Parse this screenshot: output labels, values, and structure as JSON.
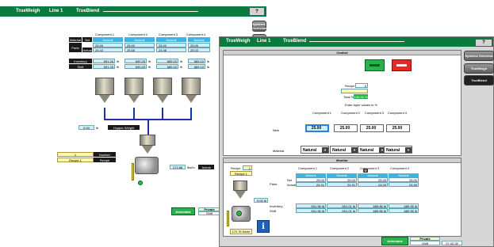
{
  "back": {
    "title_bar": {
      "app": "TrueWeigh",
      "line": "Line 1",
      "module": "TrueBlend",
      "help": "?"
    },
    "nav": {
      "systems": "Systems Overview",
      "trueweigh": "TrueWeigh"
    },
    "table": {
      "col_headers": [
        "Component 1",
        "Component 2",
        "Component 3",
        "Component 4"
      ],
      "material_label": "Material",
      "set_label": "Set",
      "parts_label": "Parts",
      "actual_label": "Actual",
      "material": [
        "Natural",
        "Natural",
        "Natural",
        "Natural"
      ],
      "set": [
        "25.00",
        "25.00",
        "25.00",
        "25.00"
      ],
      "actual": [
        "24.43",
        "25.65",
        "24.98",
        "25.03"
      ],
      "inventory_label": "Inventory",
      "shift_label": "Shift",
      "inventory": [
        "691.26",
        "690.29",
        "689.10",
        "689.10"
      ],
      "shift": [
        "691.25",
        "690.29",
        "689.10",
        "689.10"
      ],
      "unit": "lb"
    },
    "hopper_weight": {
      "value": "0.00",
      "unit": "lb",
      "label": "Hopper Weight"
    },
    "recipe": {
      "number_value": "1",
      "number_label": "Number",
      "name_value": "Recipe 1",
      "name_label": "Recipe"
    },
    "throughput": {
      "value": "172.88",
      "unit": "lbs/hr",
      "label": "Actual"
    },
    "bottom": {
      "automatic": "Automatic",
      "private": "Private",
      "shift": "Shift"
    }
  },
  "front": {
    "title_bar": {
      "app": "TrueWeigh",
      "line": "Line 1",
      "module": "TrueBlend",
      "help": "?"
    },
    "nav": {
      "systems": "Systems Overview",
      "trueweigh": "TrueWeigh",
      "trueblend": "TrueBlend"
    },
    "control": {
      "title": "Control",
      "recipe_label": "Recipe",
      "recipe_value": "0",
      "total_label": "Total %",
      "total_value": "100.00 %",
      "hint": "Enter layer values in  %",
      "col_headers": [
        "Component 1",
        "Component 2",
        "Component 3",
        "Component 4"
      ],
      "new_label": "New",
      "new_values": [
        "25.00",
        "25.00",
        "25.00",
        "25.00"
      ],
      "material_label": "Material",
      "materials": [
        "Natural",
        "Natural",
        "Natural",
        "Natural"
      ]
    },
    "monitor": {
      "title": "Monitor",
      "recipe_label": "Recipe",
      "recipe_value": "1",
      "recipe_name": "Recipe 1",
      "col_headers": [
        "Component 1",
        "Component 2",
        "Component 3",
        "Component 4"
      ],
      "materials": [
        "Natural",
        "Natural",
        "Natural",
        "Natural"
      ],
      "parts_label": "Parts",
      "set_label": "Set",
      "actual_label": "Actual",
      "set": [
        "25.00",
        "25.00",
        "25.00",
        "25.00"
      ],
      "actual": [
        "26.31",
        "24.91",
        "24.09",
        "24.69"
      ],
      "hopper_value": "0.00 lb",
      "inventory_label": "Inventory",
      "shift_label": "Shift",
      "inventory": [
        "691.96 lb",
        "691.01 lb",
        "689.86 lb",
        "689.95 lb"
      ],
      "shift": [
        "691.96 lb",
        "691.01 lb",
        "689.86 lb",
        "689.95 lb"
      ],
      "throughput": "170.76 lbs/hr"
    },
    "bottom": {
      "automatic": "Automatic",
      "private": "Private",
      "shift": "Shift",
      "time": "07:42:39"
    }
  }
}
